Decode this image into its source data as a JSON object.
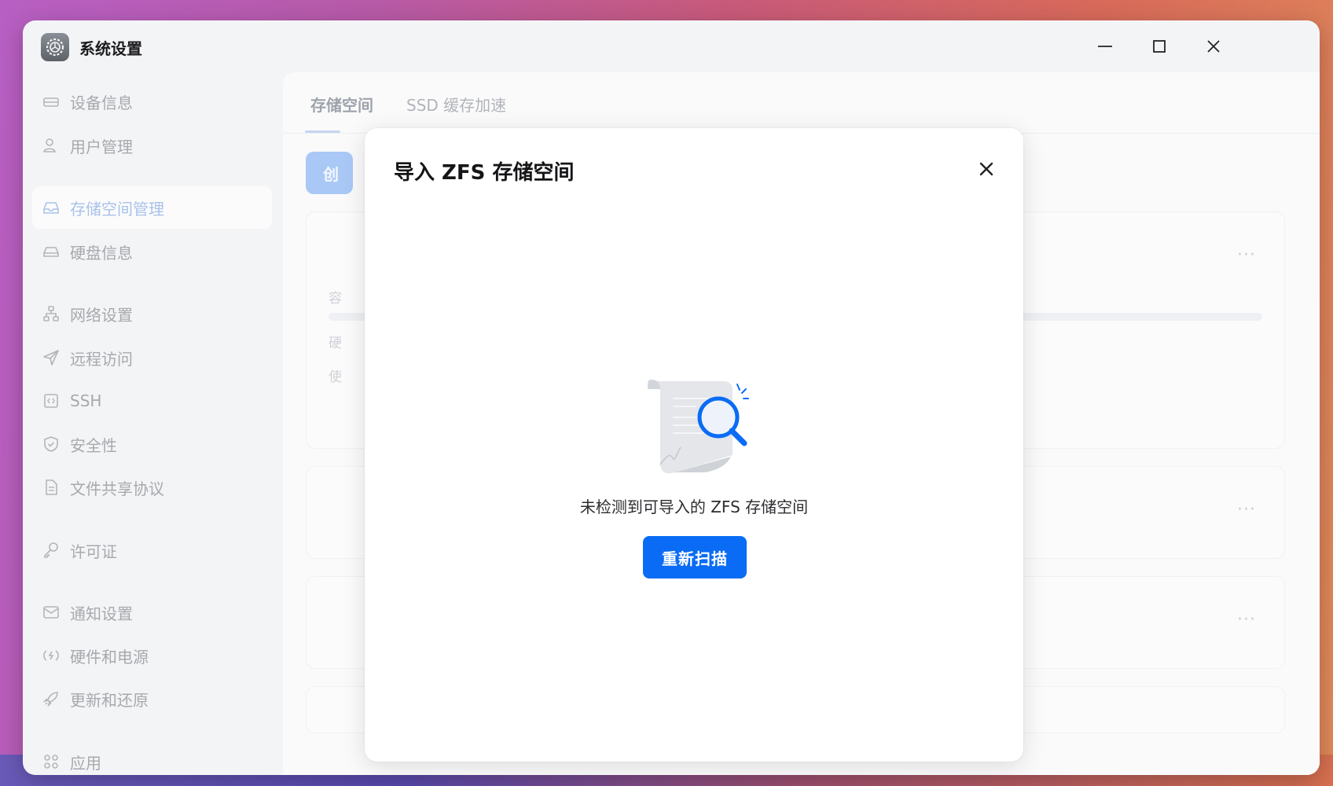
{
  "window": {
    "title": "系统设置",
    "controls": [
      "minimize",
      "maximize",
      "close"
    ]
  },
  "sidebar": {
    "items": [
      {
        "label": "设备信息",
        "icon": "device-icon",
        "active": false
      },
      {
        "label": "用户管理",
        "icon": "user-icon",
        "active": false
      },
      {
        "label": "存储空间管理",
        "icon": "storage-icon",
        "active": true
      },
      {
        "label": "硬盘信息",
        "icon": "disk-icon",
        "active": false
      },
      {
        "label": "网络设置",
        "icon": "network-icon",
        "active": false
      },
      {
        "label": "远程访问",
        "icon": "send-icon",
        "active": false
      },
      {
        "label": "SSH",
        "icon": "ssh-icon",
        "active": false
      },
      {
        "label": "安全性",
        "icon": "shield-icon",
        "active": false
      },
      {
        "label": "文件共享协议",
        "icon": "file-icon",
        "active": false
      },
      {
        "label": "许可证",
        "icon": "key-icon",
        "active": false
      },
      {
        "label": "通知设置",
        "icon": "mail-icon",
        "active": false
      },
      {
        "label": "硬件和电源",
        "icon": "power-icon",
        "active": false
      },
      {
        "label": "更新和还原",
        "icon": "rocket-icon",
        "active": false
      },
      {
        "label": "应用",
        "icon": "apps-icon",
        "active": false
      }
    ]
  },
  "main": {
    "tabs": [
      {
        "label": "存储空间",
        "active": true
      },
      {
        "label": "SSD 缓存加速",
        "active": false
      }
    ],
    "create_button_label": "创",
    "card_fragments": [
      "容",
      "硬",
      "使"
    ],
    "more_label": "···"
  },
  "dialog": {
    "title": "导入 ZFS 存储空间",
    "empty_message": "未检测到可导入的 ZFS 存储空间",
    "rescan_label": "重新扫描",
    "accent_color": "#0a6cf5"
  }
}
